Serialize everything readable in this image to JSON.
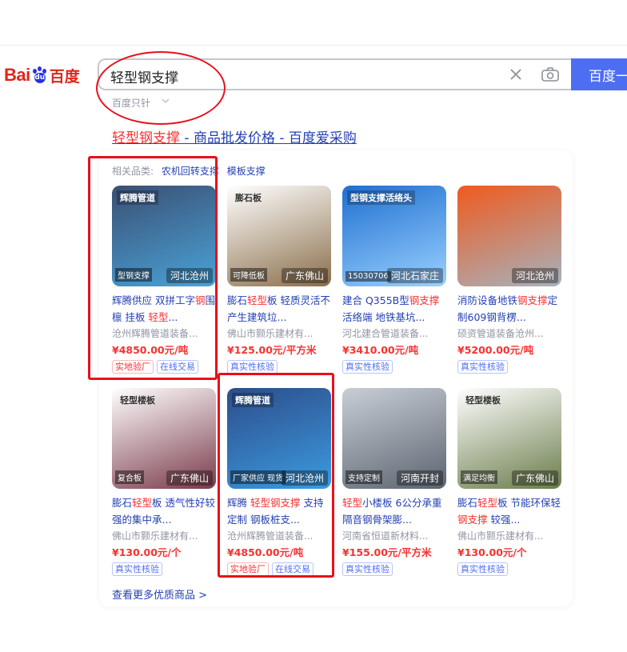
{
  "logo": {
    "part1": "Bai",
    "paw": "du",
    "part2": "百度"
  },
  "search": {
    "query": "轻型钢支撑",
    "button_label": "百度一下",
    "hint": "百度只针"
  },
  "result": {
    "title_keyword": "轻型钢支撑",
    "title_rest": " - 商品批发价格 - 百度爱采购"
  },
  "categories": {
    "label": "相关品类:",
    "items": [
      "农机回转支撑",
      "模板支撑"
    ]
  },
  "products": [
    {
      "title_parts": [
        "辉腾供应 双拼工字",
        "钢",
        "围檩 挂板 ",
        "轻型",
        "..."
      ],
      "seller": "沧州辉腾管道装备...",
      "price": "¥4850.00元/吨",
      "tags": [
        "实地验厂",
        "在线交易"
      ],
      "location": "河北沧州",
      "img_label": "辉腾管道",
      "img_corner": "型钢支撑",
      "colors": [
        "#3a4f73",
        "#4aa3d8"
      ]
    },
    {
      "title_parts": [
        "膨石",
        "轻型",
        "板 轻质灵活不产生建筑垃..."
      ],
      "seller": "佛山市颢乐建材有...",
      "price": "¥125.00元/平方米",
      "tags": [
        "真实性核验"
      ],
      "location": "广东佛山",
      "img_label": "膨石板",
      "img_corner": "可降低板",
      "colors": [
        "#ffffff",
        "#8a6e4a"
      ]
    },
    {
      "title_parts": [
        "建合 Q355B型",
        "钢支撑",
        "活络端 地铁基坑..."
      ],
      "seller": "河北建合管道装备...",
      "price": "¥3410.00元/吨",
      "tags": [
        "真实性核验"
      ],
      "location": "河北石家庄",
      "img_label": "型钢支撑活络头",
      "img_corner": "15030706",
      "colors": [
        "#1f6fd0",
        "#9ad1ff"
      ]
    },
    {
      "title_parts": [
        "消防设备地铁",
        "钢支撑",
        "定制609钢背楞..."
      ],
      "seller": "硕资管道装备沧州...",
      "price": "¥5200.00元/吨",
      "tags": [
        "真实性核验"
      ],
      "location": "河北沧州",
      "img_label": "",
      "img_corner": "",
      "colors": [
        "#ef5a1e",
        "#a7b2bd"
      ]
    },
    {
      "title_parts": [
        "膨石",
        "轻型",
        "板 透气性好较强的集中承..."
      ],
      "seller": "佛山市颢乐建材有...",
      "price": "¥130.00元/个",
      "tags": [
        "真实性核验"
      ],
      "location": "广东佛山",
      "img_label": "轻型楼板",
      "img_corner": "复合板",
      "colors": [
        "#ffffff",
        "#7a3a4a"
      ]
    },
    {
      "title_parts": [
        "辉腾 ",
        "轻型钢支撑",
        " 支持定制 钢板桩支..."
      ],
      "seller": "沧州辉腾管道装备...",
      "price": "¥4850.00元/吨",
      "tags": [
        "实地验厂",
        "在线交易"
      ],
      "location": "河北沧州",
      "img_label": "辉腾管道",
      "img_corner": "厂家供应 现货",
      "colors": [
        "#2d4d8a",
        "#3b9be0"
      ]
    },
    {
      "title_parts": [
        "轻型",
        "小楼板 6公分承重隔音钢骨架膨..."
      ],
      "seller": "河南省恒道新材料...",
      "price": "¥155.00元/平方米",
      "tags": [
        "真实性核验"
      ],
      "location": "河南开封",
      "img_label": "",
      "img_corner": "支持定制",
      "colors": [
        "#c9ced6",
        "#5b6470"
      ]
    },
    {
      "title_parts": [
        "膨石",
        "轻型",
        "板 节能环保轻",
        "钢支撑",
        " 较强..."
      ],
      "seller": "佛山市颢乐建材有...",
      "price": "¥130.00元/个",
      "tags": [
        "真实性核验"
      ],
      "location": "广东佛山",
      "img_label": "轻型楼板",
      "img_corner": "满足均衡",
      "colors": [
        "#ffffff",
        "#6a7c4a"
      ]
    }
  ],
  "more_link": "查看更多优质商品 >"
}
